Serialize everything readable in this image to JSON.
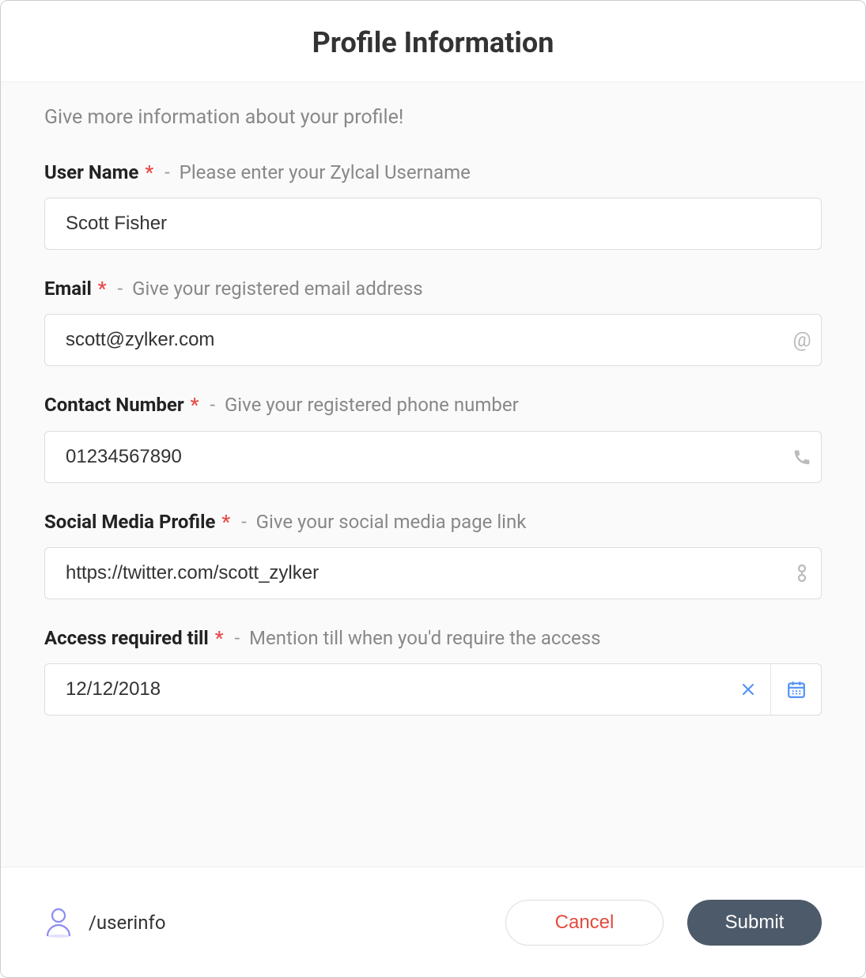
{
  "header": {
    "title": "Profile Information"
  },
  "intro": "Give more information about your profile!",
  "fields": {
    "username": {
      "label": "User Name",
      "hint": "Please enter your Zylcal Username",
      "value": "Scott Fisher"
    },
    "email": {
      "label": "Email",
      "hint": "Give your registered email address",
      "value": "scott@zylker.com"
    },
    "contact": {
      "label": "Contact Number",
      "hint": "Give your registered phone number",
      "value": "01234567890"
    },
    "social": {
      "label": "Social Media Profile",
      "hint": "Give your social media page link",
      "value": "https://twitter.com/scott_zylker"
    },
    "access": {
      "label": "Access required till",
      "hint": "Mention till when you'd require the access",
      "value": "12/12/2018"
    }
  },
  "required_marker": "*",
  "dash": "-",
  "footer": {
    "command": "/userinfo",
    "cancel": "Cancel",
    "submit": "Submit"
  }
}
